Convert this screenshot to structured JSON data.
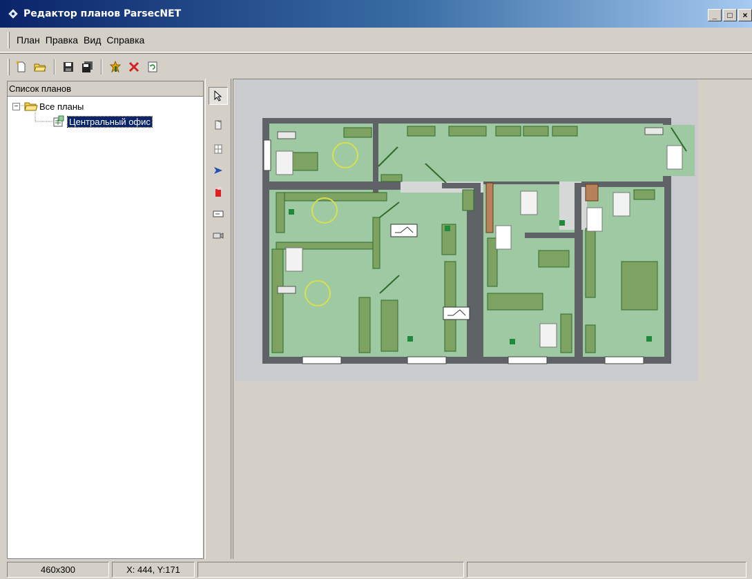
{
  "window": {
    "title": "Редактор планов ParsecNET",
    "controls": {
      "minimize": "_",
      "maximize": "□",
      "close": "×"
    }
  },
  "menu": [
    "План",
    "Правка",
    "Вид",
    "Справка"
  ],
  "toolbar": {
    "buttons": [
      "new-plan-icon",
      "open-folder-icon",
      "save-icon",
      "save-all-icon",
      "plan-properties-icon",
      "delete-icon",
      "refresh-icon"
    ]
  },
  "plans_panel": {
    "header": "Список планов",
    "root": {
      "label": "Все планы",
      "expander": "−"
    },
    "items": [
      {
        "label": "Центральный офис",
        "selected": true
      }
    ]
  },
  "tools": [
    "pointer-icon",
    "door-icon",
    "window-icon",
    "marker-icon",
    "red-object-icon",
    "reader-icon",
    "camera-icon"
  ],
  "statusbar": {
    "size": "460x300",
    "coords": "X: 444, Y:171",
    "cell3": "",
    "cell4": ""
  },
  "colors": {
    "title_bar": "#0a246a",
    "selection": "#0a246a",
    "wall": "#5f6266",
    "room_fill": "#9ec9a2",
    "furniture": "#7ea262",
    "dark_green": "#1f8a3a"
  }
}
